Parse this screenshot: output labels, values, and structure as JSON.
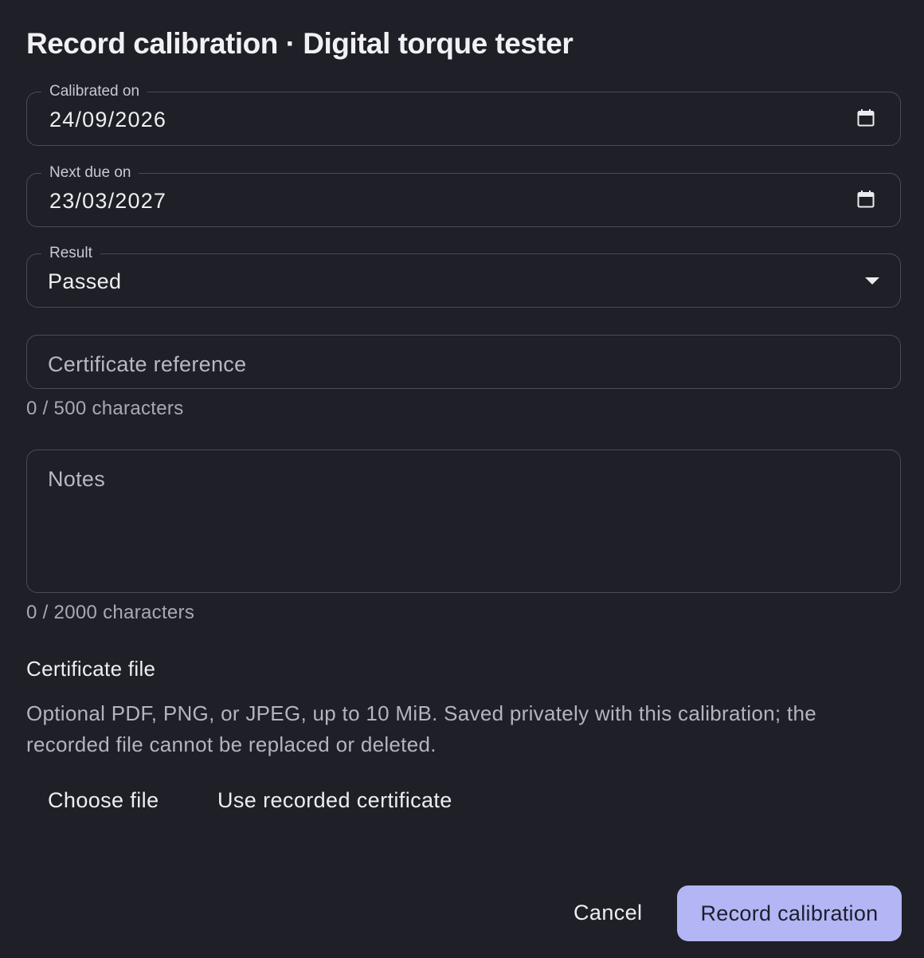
{
  "dialog": {
    "title": "Record calibration · Digital torque tester"
  },
  "calibrated_on": {
    "label": "Calibrated on",
    "value": "24/09/2026",
    "icon": "calendar-icon"
  },
  "next_due_on": {
    "label": "Next due on",
    "value": "23/03/2027",
    "icon": "calendar-icon"
  },
  "result": {
    "label": "Result",
    "selected": "Passed",
    "icon": "caret-down-icon"
  },
  "certificate_reference": {
    "placeholder": "Certificate reference",
    "counter": "0 / 500 characters"
  },
  "notes": {
    "placeholder": "Notes",
    "counter": "0 / 2000 characters"
  },
  "certificate_file": {
    "label": "Certificate file",
    "help": "Optional PDF, PNG, or JPEG, up to 10 MiB. Saved privately with this calibration; the recorded file cannot be replaced or deleted.",
    "choose_label": "Choose file",
    "use_recorded_label": "Use recorded certificate"
  },
  "actions": {
    "cancel_label": "Cancel",
    "submit_label": "Record calibration"
  },
  "colors": {
    "background": "#1e1f27",
    "border": "#4a4c56",
    "primary": "#b3b5f4"
  }
}
